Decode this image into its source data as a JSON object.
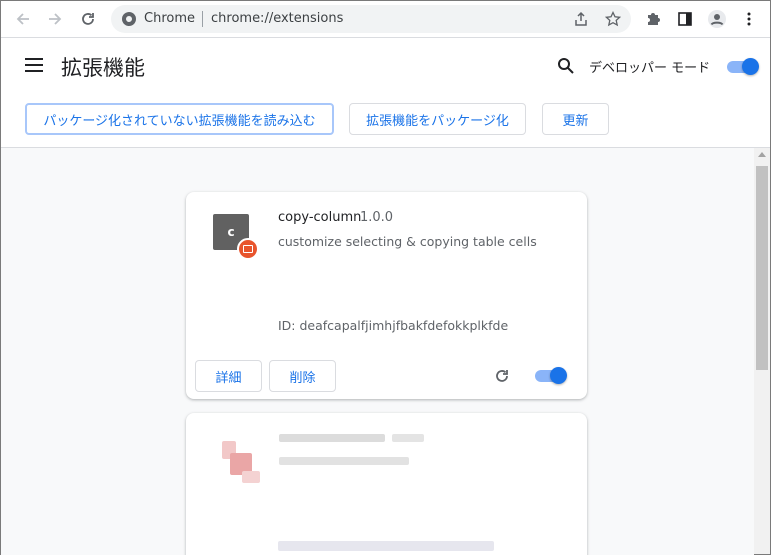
{
  "browser": {
    "site_name": "Chrome",
    "url": "chrome://extensions"
  },
  "header": {
    "title": "拡張機能",
    "developer_mode_label": "デベロッパー モード",
    "developer_mode_enabled": true
  },
  "actions": {
    "load_unpacked": "パッケージ化されていない拡張機能を読み込む",
    "pack_extension": "拡張機能をパッケージ化",
    "update": "更新"
  },
  "extensions": [
    {
      "icon_letter": "c",
      "name": "copy-column",
      "version": "1.0.0",
      "description": "customize selecting & copying table cells",
      "id": "ID: deafcapalfjimhjfbakfdefokkplkfde",
      "details_label": "詳細",
      "remove_label": "削除",
      "enabled": true
    }
  ],
  "colors": {
    "accent": "#1a73e8",
    "toggle_track": "#8ab4f8",
    "badge": "#e8552d"
  }
}
